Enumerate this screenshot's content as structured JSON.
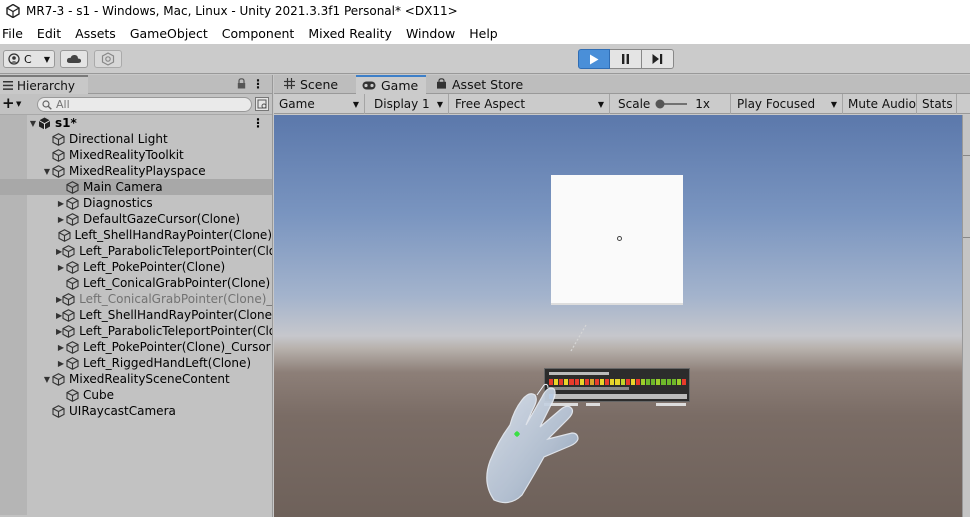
{
  "window": {
    "title": "MR7-3 - s1 - Windows, Mac, Linux - Unity 2021.3.3f1 Personal* <DX11>"
  },
  "menu": [
    "File",
    "Edit",
    "Assets",
    "GameObject",
    "Component",
    "Mixed Reality",
    "Window",
    "Help"
  ],
  "toolbar": {
    "account_label": "C",
    "icons": [
      "user-icon",
      "cloud-icon",
      "collab-icon",
      "play-icon",
      "pause-icon",
      "step-icon"
    ]
  },
  "hierarchy": {
    "tab_label": "Hierarchy",
    "add_label": "+",
    "search_placeholder": "All",
    "scene": "s1*",
    "items": [
      {
        "label": "Directional Light",
        "depth": 1,
        "arrow": "",
        "dim": false,
        "selected": false
      },
      {
        "label": "MixedRealityToolkit",
        "depth": 1,
        "arrow": "",
        "dim": false,
        "selected": false
      },
      {
        "label": "MixedRealityPlayspace",
        "depth": 1,
        "arrow": "▼",
        "dim": false,
        "selected": false
      },
      {
        "label": "Main Camera",
        "depth": 2,
        "arrow": "",
        "dim": false,
        "selected": true
      },
      {
        "label": "Diagnostics",
        "depth": 2,
        "arrow": "▶",
        "dim": false,
        "selected": false
      },
      {
        "label": "DefaultGazeCursor(Clone)",
        "depth": 2,
        "arrow": "▶",
        "dim": false,
        "selected": false
      },
      {
        "label": "Left_ShellHandRayPointer(Clone)",
        "depth": 2,
        "arrow": "",
        "dim": false,
        "selected": false
      },
      {
        "label": "Left_ParabolicTeleportPointer(Clo",
        "depth": 2,
        "arrow": "▶",
        "dim": false,
        "selected": false
      },
      {
        "label": "Left_PokePointer(Clone)",
        "depth": 2,
        "arrow": "▶",
        "dim": false,
        "selected": false
      },
      {
        "label": "Left_ConicalGrabPointer(Clone)",
        "depth": 2,
        "arrow": "",
        "dim": false,
        "selected": false
      },
      {
        "label": "Left_ConicalGrabPointer(Clone)_I",
        "depth": 2,
        "arrow": "▶",
        "dim": true,
        "selected": false
      },
      {
        "label": "Left_ShellHandRayPointer(Clone)",
        "depth": 2,
        "arrow": "▶",
        "dim": false,
        "selected": false
      },
      {
        "label": "Left_ParabolicTeleportPointer(Clo",
        "depth": 2,
        "arrow": "▶",
        "dim": false,
        "selected": false
      },
      {
        "label": "Left_PokePointer(Clone)_Cursor",
        "depth": 2,
        "arrow": "▶",
        "dim": false,
        "selected": false
      },
      {
        "label": "Left_RiggedHandLeft(Clone)",
        "depth": 2,
        "arrow": "▶",
        "dim": false,
        "selected": false
      },
      {
        "label": "MixedRealitySceneContent",
        "depth": 1,
        "arrow": "▼",
        "dim": false,
        "selected": false
      },
      {
        "label": "Cube",
        "depth": 2,
        "arrow": "",
        "dim": false,
        "selected": false
      },
      {
        "label": "UIRaycastCamera",
        "depth": 1,
        "arrow": "",
        "dim": false,
        "selected": false
      }
    ]
  },
  "tabs": [
    {
      "label": "Scene",
      "icon": "hash-icon",
      "active": false
    },
    {
      "label": "Game",
      "icon": "gamepad-icon",
      "active": true
    },
    {
      "label": "Asset Store",
      "icon": "bag-icon",
      "active": false
    }
  ],
  "game_toolbar": {
    "display_mode": "Game",
    "display": "Display 1",
    "aspect": "Free Aspect",
    "scale_label": "Scale",
    "scale_value": "1x",
    "play_mode": "Play Focused",
    "mute": "Mute Audio",
    "stats": "Stats"
  },
  "colors": {
    "play_active": "#4a8fd8",
    "tab_accent": "#3d7fc8",
    "sky_top": "#5b78ab",
    "ground": "#7a6c65"
  }
}
